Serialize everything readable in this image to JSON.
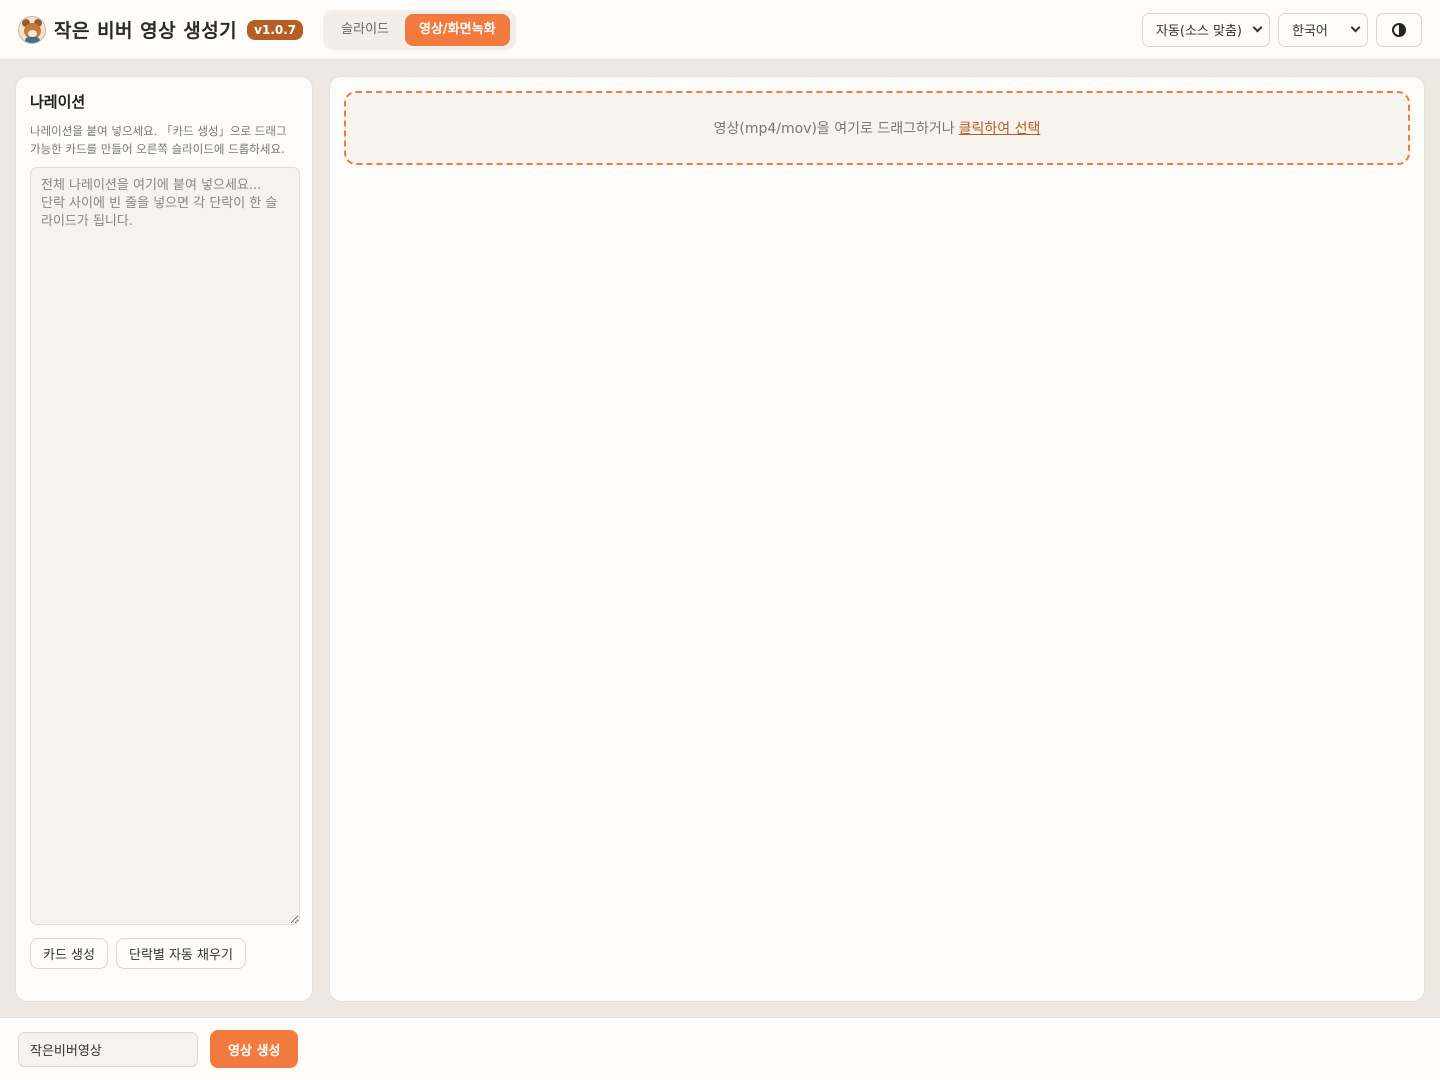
{
  "header": {
    "app_title": "작은 비버 영상 생성기",
    "version": "v1.0.7",
    "tabs": [
      {
        "label": "슬라이드",
        "active": false
      },
      {
        "label": "영상/화면녹화",
        "active": true
      }
    ],
    "resolution_select": "자동(소스 맞춤)",
    "language_select": "한국어",
    "theme_icon": "half-circle-icon"
  },
  "left_panel": {
    "title": "나레이션",
    "description": "나레이션을 붙여 넣으세요. 「카드 생성」으로 드래그 가능한 카드를 만들어 오른쪽 슬라이드에 드롭하세요.",
    "textarea_placeholder": "전체 나레이션을 여기에 붙여 넣으세요...\n단락 사이에 빈 줄을 넣으면 각 단락이 한 슬라이드가 됩니다.",
    "buttons": {
      "create_cards": "카드 생성",
      "auto_fill": "단락별 자동 채우기"
    }
  },
  "right_panel": {
    "dropzone_text": "영상(mp4/mov)을 여기로 드래그하거나",
    "dropzone_link": "클릭하여 선택"
  },
  "footer": {
    "filename_value": "작은비버영상",
    "generate_button": "영상 생성"
  },
  "colors": {
    "accent": "#f27a3e",
    "version_badge": "#b55f24",
    "background": "#ede9e2",
    "panel": "#fdfcf8"
  }
}
